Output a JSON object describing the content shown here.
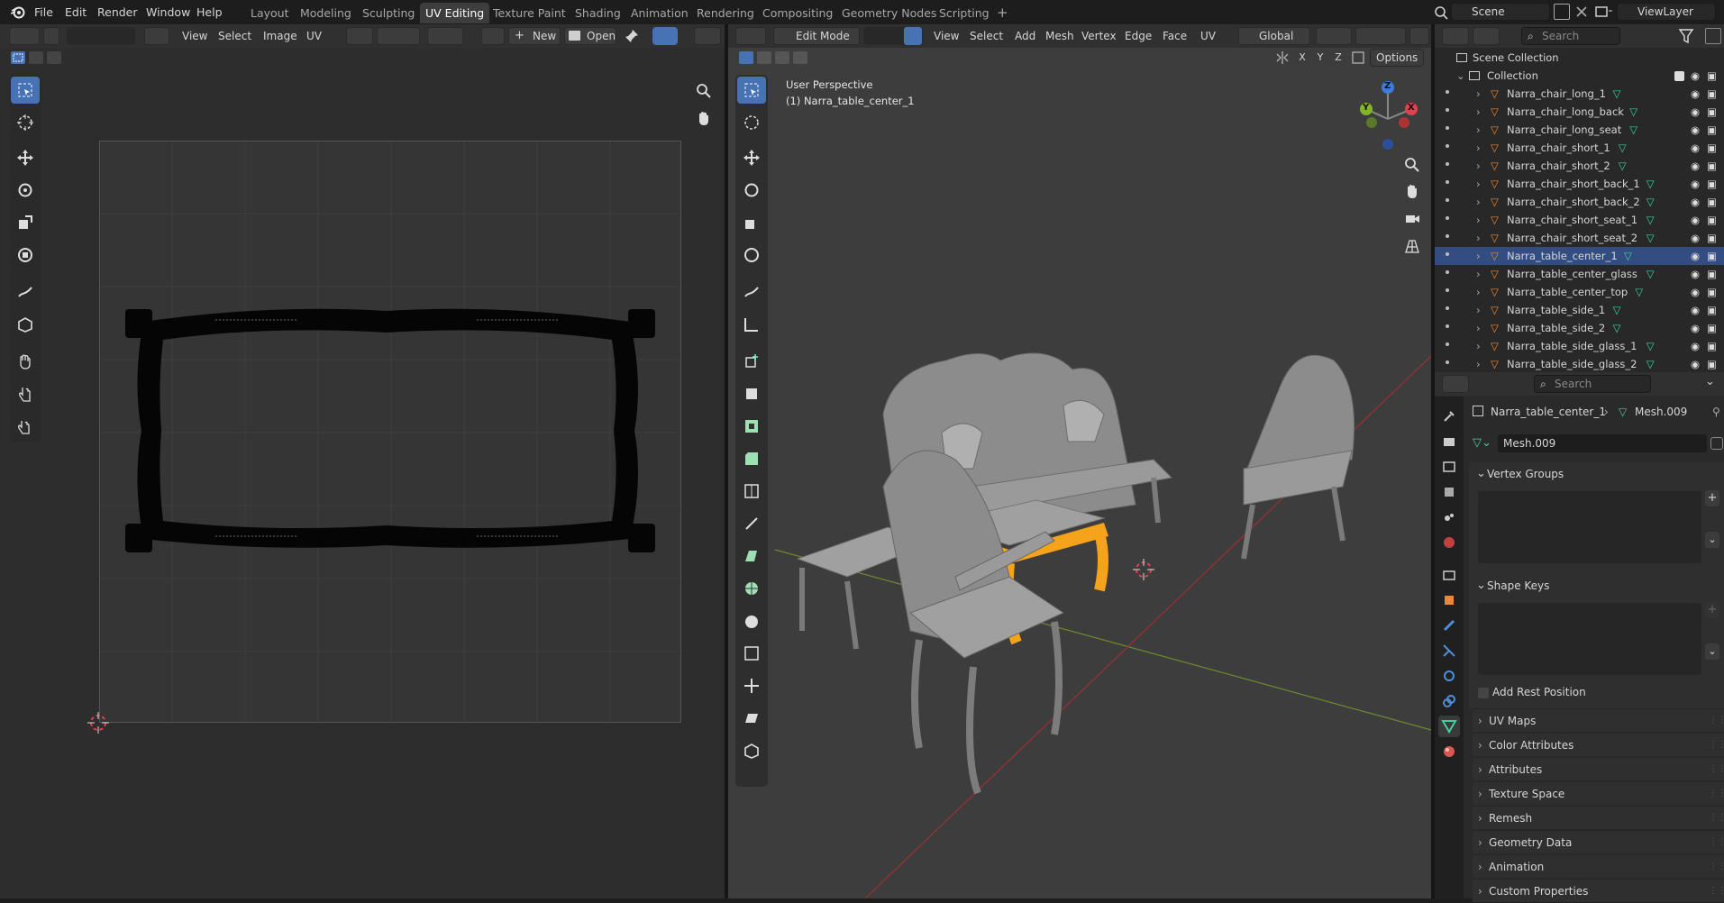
{
  "topbar": {
    "menus": [
      "File",
      "Edit",
      "Render",
      "Window",
      "Help"
    ],
    "workspaces": [
      "Layout",
      "Modeling",
      "Sculpting",
      "UV Editing",
      "Texture Paint",
      "Shading",
      "Animation",
      "Rendering",
      "Compositing",
      "Geometry Nodes",
      "Scripting"
    ],
    "active_workspace": "UV Editing",
    "add_tab": "+",
    "scene": "Scene",
    "view_layer": "ViewLayer"
  },
  "uv_editor": {
    "menus": [
      "View",
      "Select",
      "Image",
      "UV"
    ],
    "new_label": "New",
    "open_label": "Open"
  },
  "viewport": {
    "mode": "Edit Mode",
    "menus": [
      "View",
      "Select",
      "Add",
      "Mesh",
      "Vertex",
      "Edge",
      "Face",
      "UV"
    ],
    "transform_orientation": "Global",
    "options_label": "Options",
    "axes_lock": [
      "X",
      "Y",
      "Z"
    ],
    "overlay_line1": "User Perspective",
    "overlay_line2": "(1) Narra_table_center_1",
    "gizmo_axes": [
      "Z",
      "Y",
      "X"
    ]
  },
  "outliner": {
    "search_placeholder": "Search",
    "scene_collection": "Scene Collection",
    "collection": "Collection",
    "selected_index": 8,
    "items": [
      "Narra_chair_long_1",
      "Narra_chair_long_back",
      "Narra_chair_long_seat",
      "Narra_chair_short_1",
      "Narra_chair_short_2",
      "Narra_chair_short_back_1",
      "Narra_chair_short_back_2",
      "Narra_chair_short_seat_1",
      "Narra_chair_short_seat_2",
      "Narra_table_center_1",
      "Narra_table_center_glass",
      "Narra_table_center_top",
      "Narra_table_side_1",
      "Narra_table_side_2",
      "Narra_table_side_glass_1",
      "Narra_table_side_glass_2"
    ]
  },
  "properties": {
    "search_placeholder": "Search",
    "object_name": "Narra_table_center_1",
    "mesh_name": "Mesh.009",
    "mesh_field": "Mesh.009",
    "vertex_groups": "Vertex Groups",
    "shape_keys": "Shape Keys",
    "add_rest_position": "Add Rest Position",
    "panels": [
      "UV Maps",
      "Color Attributes",
      "Attributes",
      "Texture Space",
      "Remesh",
      "Geometry Data",
      "Animation",
      "Custom Properties"
    ]
  },
  "colors": {
    "accent": "#4772b3",
    "selection_orange": "#f5a31a",
    "axis_x": "#e0414e",
    "axis_y": "#82b627",
    "axis_z": "#3c7ddb"
  }
}
